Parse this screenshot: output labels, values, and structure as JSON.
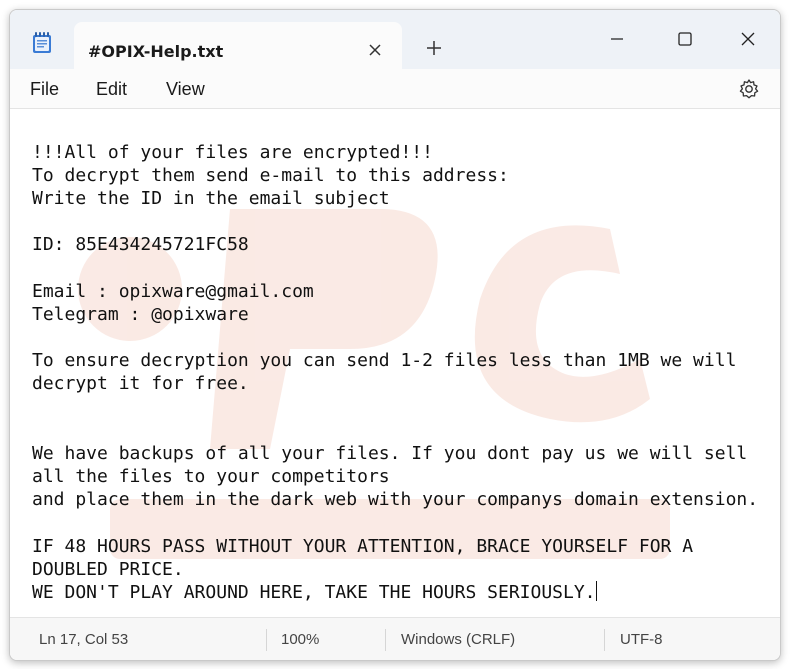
{
  "tab": {
    "title": "#OPIX-Help.txt"
  },
  "menu": {
    "file": "File",
    "edit": "Edit",
    "view": "View"
  },
  "editor": {
    "lines": [
      "!!!All of your files are encrypted!!!",
      "To decrypt them send e-mail to this address:",
      "Write the ID in the email subject",
      "",
      "ID: 85E434245721FC58",
      "",
      "Email : opixware@gmail.com",
      "Telegram : @opixware",
      "",
      "To ensure decryption you can send 1-2 files less than 1MB we will",
      "decrypt it for free.",
      "",
      "",
      "We have backups of all your files. If you dont pay us we will sell",
      "all the files to your competitors",
      "and place them in the dark web with your companys domain extension.",
      "",
      "IF 48 HOURS PASS WITHOUT YOUR ATTENTION, BRACE YOURSELF FOR A",
      "DOUBLED PRICE.",
      "WE DON'T PLAY AROUND HERE, TAKE THE HOURS SERIOUSLY."
    ]
  },
  "status": {
    "position": "Ln 17, Col 53",
    "zoom": "100%",
    "line_ending": "Windows (CRLF)",
    "encoding": "UTF-8"
  },
  "icons": {
    "app": "notepad-icon",
    "tab_close": "close-icon",
    "new_tab": "plus-icon",
    "minimize": "minimize-icon",
    "maximize": "maximize-icon",
    "close": "close-icon",
    "settings": "gear-icon"
  }
}
